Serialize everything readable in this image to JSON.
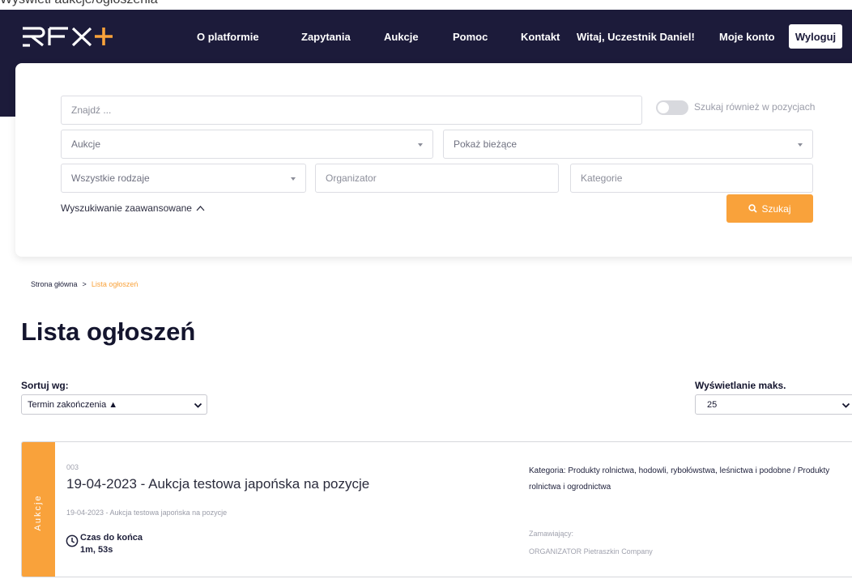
{
  "top_strip_text": "Wyświetl aukcje/ogłoszenia",
  "header": {
    "logo": "RFX+",
    "nav": [
      "O platformie",
      "Zapytania",
      "Aukcje",
      "Pomoc",
      "Kontakt"
    ],
    "greeting": "Witaj, Uczestnik Daniel!",
    "account": "Moje konto",
    "logout": "Wyloguj"
  },
  "search": {
    "query_placeholder": "Znajdź ...",
    "toggle_label": "Szukaj również w pozycjach",
    "type_value": "Aukcje",
    "status_value": "Pokaż bieżące",
    "kind_value": "Wszystkie rodzaje",
    "organizer_placeholder": "Organizator",
    "category_placeholder": "Kategorie",
    "advanced": "Wyszukiwanie zaawansowane",
    "button": "Szukaj"
  },
  "breadcrumb": {
    "home": "Strona główna",
    "separator": ">",
    "current": "Lista ogłoszeń"
  },
  "page_title": "Lista ogłoszeń",
  "sort": {
    "label": "Sortuj wg:",
    "value": "Termin zakończenia ▲"
  },
  "display_max": {
    "label": "Wyświetlanie maks.",
    "value": "25"
  },
  "listings": [
    {
      "type": "Aukcje",
      "id": "003",
      "title": "19-04-2023 - Aukcja testowa japońska na pozycje",
      "subtitle": "19-04-2023 - Aukcja testowa japońska na pozycje",
      "time_label": "Czas do końca",
      "time_value": "1m, 53s",
      "category": "Kategoria: Produkty rolnictwa, hodowli, rybołówstwa, leśnictwa i podobne / Produkty rolnictwa i ogrodnictwa",
      "buyer_label": "Zamawiający:",
      "buyer": "ORGANIZATOR Pietraszkin Company"
    }
  ],
  "colors": {
    "navy": "#1c1b3a",
    "accent": "#f9a23b"
  },
  "icons": {
    "search": "magnifier-icon",
    "chevron_up": "chevron-up-icon",
    "select": "chevron-down-icon",
    "clock": "clock-icon"
  }
}
